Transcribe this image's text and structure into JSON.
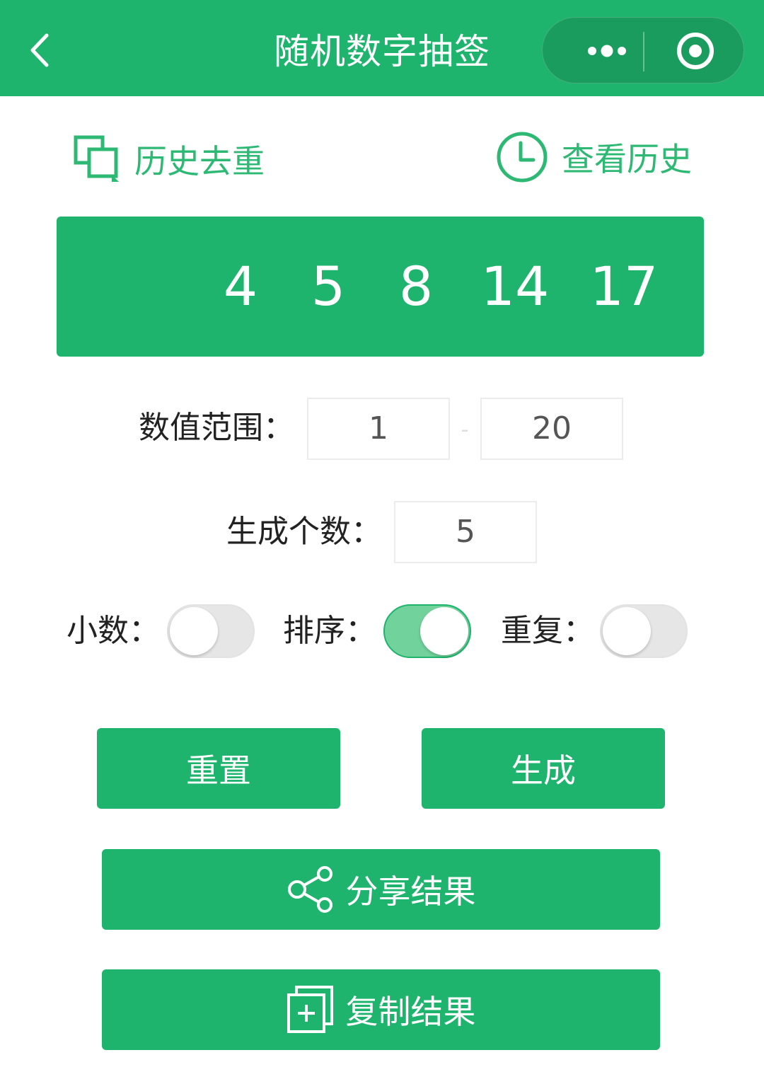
{
  "header": {
    "title": "随机数字抽签",
    "icons": {
      "back": "chevron-left-icon",
      "more": "more-dots-icon",
      "close": "target-circle-icon"
    }
  },
  "links": {
    "dedupe": {
      "label": "历史去重",
      "icon": "copy-window-icon"
    },
    "history": {
      "label": "查看历史",
      "icon": "clock-icon"
    }
  },
  "result": {
    "numbers": [
      "4",
      "5",
      "8",
      "14",
      "17"
    ]
  },
  "range": {
    "label": "数值范围：",
    "min": "1",
    "dash": "-",
    "max": "20"
  },
  "count": {
    "label": "生成个数：",
    "value": "5"
  },
  "toggles": [
    {
      "label": "小数：",
      "on": false
    },
    {
      "label": "排序：",
      "on": true
    },
    {
      "label": "重复：",
      "on": false
    }
  ],
  "buttons": {
    "reset": "重置",
    "generate": "生成",
    "share": {
      "label": "分享结果",
      "icon": "share-icon"
    },
    "copy": {
      "label": "复制结果",
      "icon": "copy-add-icon"
    }
  },
  "colors": {
    "primary": "#1fb46e",
    "toggle_on": "#71d39b",
    "link": "#2db873"
  }
}
